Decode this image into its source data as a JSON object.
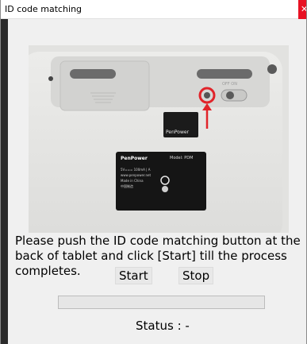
{
  "window": {
    "title": "ID code matching",
    "close_icon": "close-icon"
  },
  "photo": {
    "brand_label": "PenPower",
    "panel_title": "PenPower",
    "panel_model": "Model: PDM",
    "panel_text_1": "5V=== 100mA | A",
    "panel_text_2": "www.penpower.net",
    "panel_text_3": "Made in China",
    "panel_text_4": "中国制造",
    "switch_label": "OFF  ON",
    "indicator_color": "#e1242a"
  },
  "main": {
    "instruction": "Please push the ID code matching button at the back of tablet and click [Start] till the process completes.",
    "start_label": "Start",
    "stop_label": "Stop",
    "progress": 0,
    "status_text": "Status : -"
  }
}
